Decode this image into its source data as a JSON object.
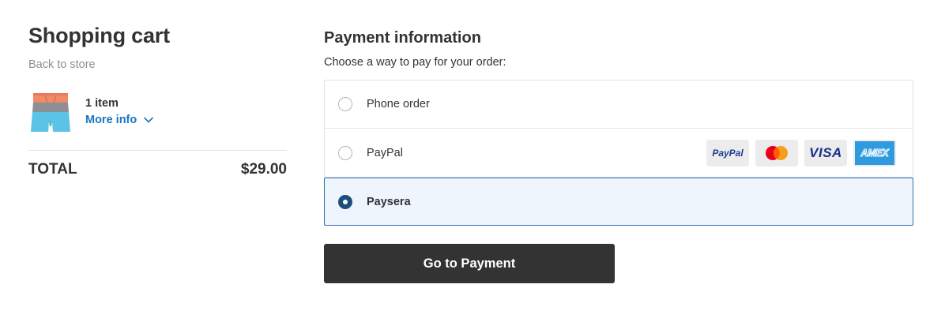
{
  "cart": {
    "title": "Shopping cart",
    "back_link": "Back to store",
    "item_count": "1 item",
    "more_info": "More info",
    "total_label": "TOTAL",
    "total_value": "$29.00",
    "product_image_icon": "board-shorts-thumbnail"
  },
  "payment": {
    "title": "Payment information",
    "subtitle": "Choose a way to pay for your order:",
    "methods": [
      {
        "label": "Phone order",
        "selected": false
      },
      {
        "label": "PayPal",
        "selected": false
      },
      {
        "label": "Paysera",
        "selected": true
      }
    ],
    "card_logos": {
      "paypal": "PayPal",
      "mastercard": "mastercard-icon",
      "visa": "VISA",
      "amex": "AMEX"
    },
    "go_button": "Go to Payment"
  },
  "colors": {
    "link": "#1976c4",
    "selected_bg": "#eef5fc",
    "selected_border": "#2c6fb0",
    "button_bg": "#333333"
  }
}
